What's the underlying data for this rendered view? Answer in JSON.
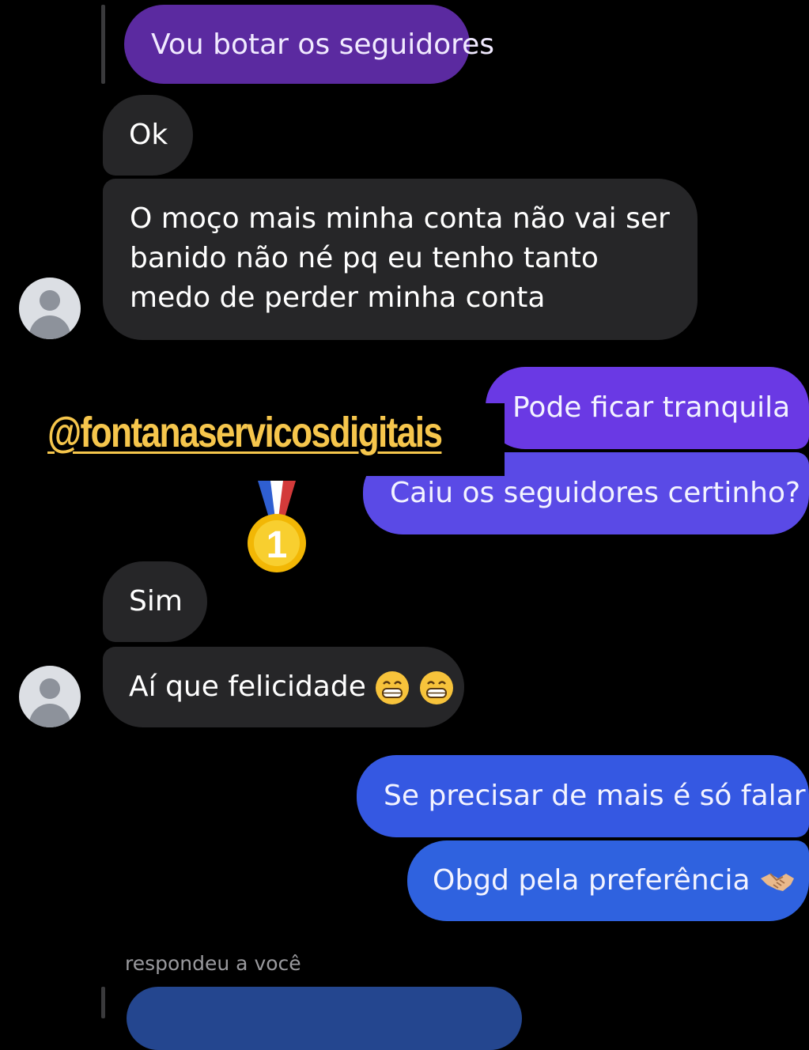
{
  "watermark": "@fontanaservicosdigitais",
  "messages": {
    "m1": "Vou botar os seguidores",
    "m2": "Ok",
    "m3": "O moço mais minha conta não vai ser banido não né pq eu tenho tanto medo de perder minha conta",
    "m4": "Pode ficar tranquila",
    "m5": "Caiu os seguidores certinho?",
    "m6": "Sim",
    "m7": "Aí que felicidade",
    "m8": "Se precisar de mais é só falar",
    "m9": "Obgd pela preferência"
  },
  "status": {
    "reply_label": "respondeu a você"
  },
  "colors": {
    "background": "#000000",
    "incoming_bubble": "#262628",
    "reply_bubble": "#5b2aa0",
    "outgoing_gradient_top": "#7a3ee0",
    "outgoing_gradient_bottom": "#2f62df",
    "watermark": "#f6c64c"
  },
  "icons": {
    "medal": "first-place-medal-icon",
    "grin": "grinning-face-icon",
    "handshake": "handshake-icon",
    "avatar": "default-avatar-icon"
  }
}
